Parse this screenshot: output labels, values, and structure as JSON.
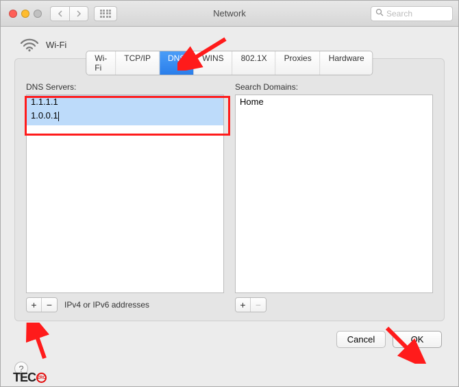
{
  "window": {
    "title": "Network",
    "search_placeholder": "Search"
  },
  "connection": {
    "name": "Wi-Fi"
  },
  "tabs": [
    "Wi-Fi",
    "TCP/IP",
    "DNS",
    "WINS",
    "802.1X",
    "Proxies",
    "Hardware"
  ],
  "active_tab_index": 2,
  "dns_panel": {
    "left_label": "DNS Servers:",
    "right_label": "Search Domains:",
    "dns_servers": [
      "1.1.1.1",
      "1.0.0.1"
    ],
    "selected_dns_index": 0,
    "editing_dns_index": 1,
    "domains": [
      "Home"
    ],
    "footnote": "IPv4 or IPv6 addresses"
  },
  "buttons": {
    "cancel": "Cancel",
    "ok": "OK"
  },
  "watermark": {
    "part1": "TEC",
    "circle": "ZRC",
    "part2": ""
  }
}
